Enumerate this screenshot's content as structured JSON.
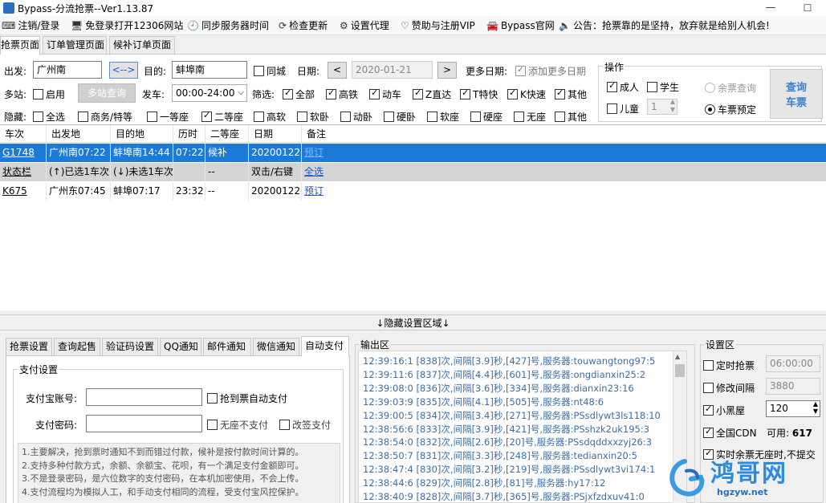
{
  "window": {
    "title": "Bypass-分流抢票--Ver1.13.87",
    "minimize": "—",
    "maximize": "☐"
  },
  "menu": [
    {
      "label": "注销/登录",
      "icon": "keyboard-icon",
      "glyph": "⌨"
    },
    {
      "label": "免登录打开12306网站",
      "icon": "browser-icon",
      "glyph": "🖥"
    },
    {
      "label": "同步服务器时间",
      "icon": "clock-icon",
      "glyph": "🕘"
    },
    {
      "label": "检查更新",
      "icon": "refresh-icon",
      "glyph": "⟳"
    },
    {
      "label": "设置代理",
      "icon": "gear-icon",
      "glyph": "⚙"
    },
    {
      "label": "赞助与注册VIP",
      "icon": "heart-icon",
      "glyph": "♡"
    },
    {
      "label": "Bypass官网",
      "icon": "car-icon",
      "glyph": "🚘"
    },
    {
      "label": "公告：抢票靠的是坚持，放弃就是给别人机会!",
      "icon": "speaker-icon",
      "glyph": "🔈"
    }
  ],
  "main_tabs": [
    "抢票页面",
    "订单管理页面",
    "候补订单页面"
  ],
  "query": {
    "from_label": "出发:",
    "from_value": "广州南",
    "swap_label": "<-->",
    "to_label": "目的:",
    "to_value": "蚌埠南",
    "same_city": "同城",
    "date_label": "日期:",
    "date_prev": "<",
    "date_value": "2020-01-21",
    "date_next": ">",
    "more_dates_label": "更多日期:",
    "add_more_dates": "添加更多日期",
    "multi_label": "多站:",
    "multi_enable": "启用",
    "multi_query_btn": "多站查询",
    "depart_label": "发车:",
    "depart_value": "00:00-24:00",
    "filter_label": "筛选:",
    "filters": [
      "全部",
      "高铁",
      "动车",
      "Z直达",
      "T特快",
      "K快速",
      "其他"
    ],
    "hide_label": "隐藏:",
    "hide_options": [
      "全选",
      "商务/特等",
      "一等座",
      "二等座",
      "高软",
      "软卧",
      "动卧",
      "硬卧",
      "软座",
      "硬座",
      "无座",
      "其他"
    ]
  },
  "operation": {
    "title": "操作",
    "adult": "成人",
    "student": "学生",
    "child": "儿童",
    "child_count": "1",
    "remain_query": "余票查询",
    "reserve": "车票预定",
    "query_btn_line1": "查询",
    "query_btn_line2": "车票"
  },
  "grid": {
    "headers": [
      "车次",
      "出发地",
      "目的地",
      "历时",
      "二等座",
      "日期",
      "备注"
    ],
    "rows": [
      [
        "G1748",
        "广州南07:22",
        "蚌埠南14:44",
        "07:22",
        "候补",
        "20200122",
        "预订"
      ],
      [
        "状态栏",
        "(↑)已选1车次",
        "(↓)未选1车次",
        "",
        "--",
        "双击/右键",
        "全选"
      ],
      [
        "K675",
        "广州东07:45",
        "蚌埠07:17",
        "23:32",
        "--",
        "20200122",
        "预订"
      ]
    ]
  },
  "divider_label": "↓隐藏设置区域↓",
  "bottom_tabs": [
    "抢票设置",
    "查询起售",
    "验证码设置",
    "QQ通知",
    "邮件通知",
    "微信通知",
    "自动支付"
  ],
  "payment": {
    "title": "支付设置",
    "alipay_label": "支付宝账号:",
    "alipay_value": "",
    "auto_pay": "抢到票自动支付",
    "password_label": "支付密码:",
    "password_value": "",
    "no_seat_no_pay": "无座不支付",
    "change_sign_pay": "改签支付",
    "notes": [
      "1.主要解决，抢到票时通知不到而错过付款，候补是按付款时间计算的。",
      "2.支持多种付款方式，余额、余额宝、花呗，有一个满足支付金额即可。",
      "3.不是登录密码，是六位数字的支付密码，在本机加密使用，不会上传。",
      "4.支付流程均为模拟人工，和手动支付相同的流程，受支付宝风控保护。"
    ]
  },
  "output": {
    "title": "输出区",
    "lines": [
      "12:39:16:1   [838]次,间隔[3.9]秒,[427]号,服务器:touwangtong97:5",
      "12:39:11:6   [837]次,间隔[4.4]秒,[601]号,服务器:ongdianxin25:2",
      "12:39:08:0   [836]次,间隔[3.6]秒,[334]号,服务器:dianxin23:16",
      "12:39:03:9   [835]次,间隔[4.1]秒,[505]号,服务器:nt48:6",
      "12:39:00:5   [834]次,间隔[3.4]秒,[271]号,服务器:PSsdlywt3ls118:10",
      "12:38:56:6   [833]次,间隔[3.9]秒,[421]号,服务器:PSshzk2uk195:3",
      "12:38:54:0   [832]次,间隔[2.6]秒,[20]号,服务器:PSsdqddxxzyj26:3",
      "12:38:50:7   [831]次,间隔[3.3]秒,[248]号,服务器:tedianxin20:5",
      "12:38:47:4   [830]次,间隔[3.2]秒,[219]号,服务器:PSsdlywt3vi174:1",
      "12:38:44:6   [829]次,间隔[2.8]秒,[81]号,服务器:hy17:12",
      "12:38:40:9   [828]次,间隔[3.7]秒,[365]号,服务器:PSjxfzdxuv41:0"
    ]
  },
  "settings": {
    "title": "设置区",
    "timed_grab": "定时抢票",
    "timed_value": "06:00:00",
    "modify_interval": "修改间隔",
    "interval_value": "3880",
    "blacklist": "小黑屋",
    "blacklist_value": "120",
    "all_cdn": "全国CDN",
    "available_label": "可用:",
    "available_value": "617",
    "realtime_no_seat": "实时余票无座时,不提交"
  },
  "watermark": {
    "text": "鸿哥网",
    "url": "hgzyw.net"
  },
  "colors": {
    "selected_row": "#1e7ad7",
    "link": "#1a56d6",
    "log_text": "#3c6ea8"
  }
}
